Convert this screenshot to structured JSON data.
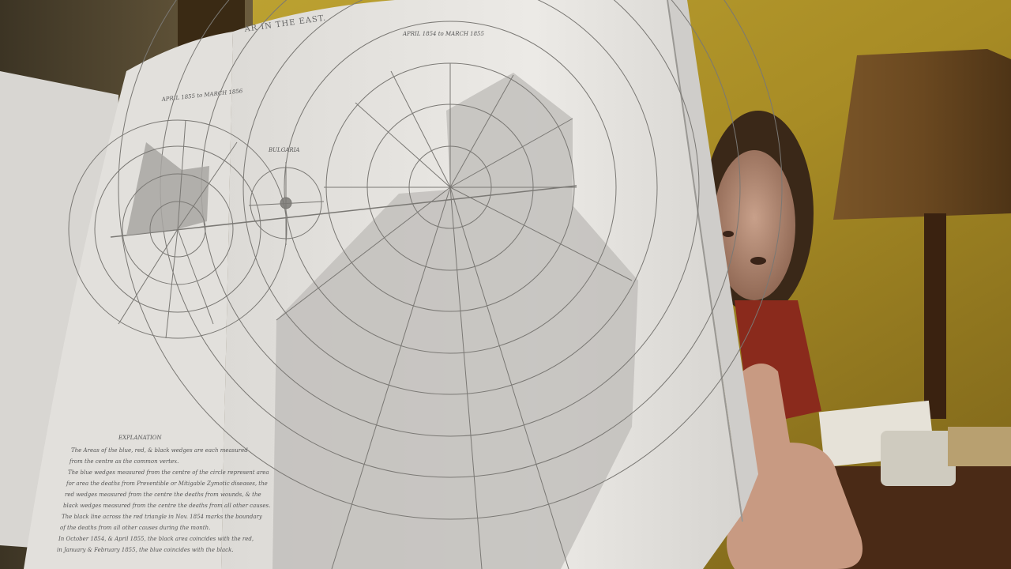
{
  "photo": {
    "description_hidden": "",
    "page_header": "AR IN THE EAST.",
    "sub_header": "APRIL 1854 to MARCH 1855",
    "left_sub_header": "APRIL 1855 to MARCH 1856",
    "small_diagram_label": "BULGARIA",
    "explanation_title": "EXPLANATION",
    "explanation_lines": [
      "The Areas of the blue, red, & black wedges are each measured",
      "from the centre as the common vertex.",
      "The blue wedges measured from the centre of the circle represent area",
      "for area the deaths from Preventible or Mitigable Zymotic diseases, the",
      "red wedges measured from the centre the deaths from wounds, & the",
      "black wedges measured from the centre the deaths from all other causes.",
      "The black line across the red triangle in Nov. 1854 marks the boundary",
      "of the deaths from all other causes during the month.",
      "In October 1854, & April 1855, the black area coincides with the red,",
      "in January & February 1855, the blue coincides with the black."
    ],
    "colors": {
      "wall": "#b59a2c",
      "page": "#e8e6e2",
      "lamp_shade": "#6b4a22",
      "wedge_fill": "#bdbab6"
    }
  }
}
